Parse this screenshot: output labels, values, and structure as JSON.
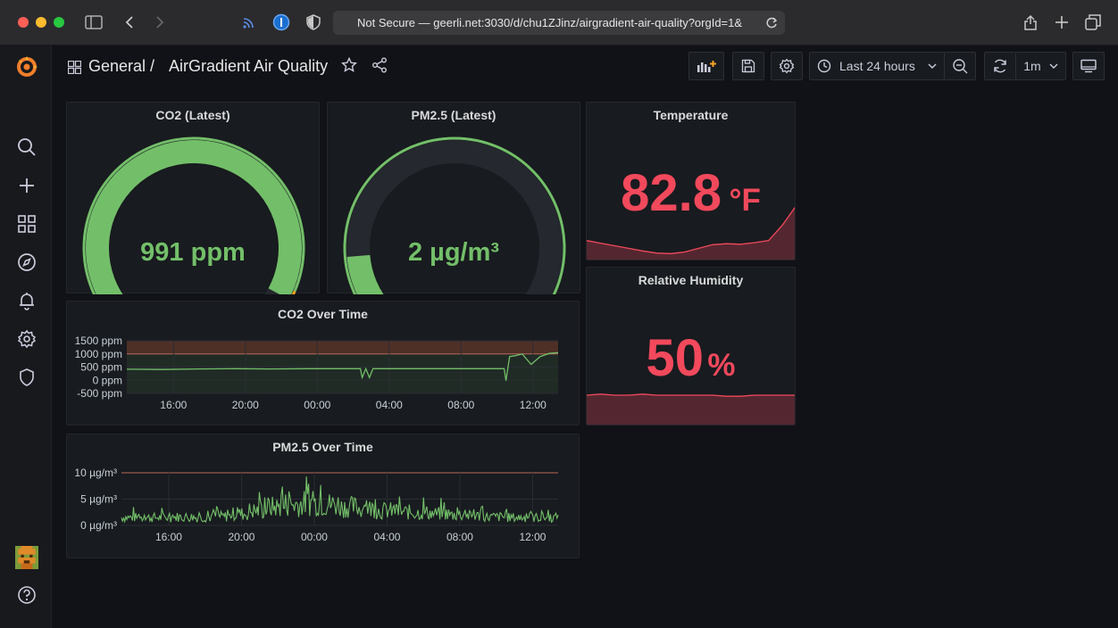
{
  "browser": {
    "url": "Not Secure — geerli.net:3030/d/chu1ZJinz/airgradient-air-quality?orgId=1&"
  },
  "nav": {
    "folder": "General",
    "separator": "/",
    "dashboard_title": "AirGradient Air Quality",
    "time_range": "Last 24 hours",
    "refresh": "1m"
  },
  "panels": {
    "co2_latest": {
      "title": "CO2 (Latest)",
      "value": "991 ppm",
      "gauge_fraction": 0.95,
      "color": "#73bf69"
    },
    "pm25_latest": {
      "title": "PM2.5 (Latest)",
      "value": "2 µg/m³",
      "gauge_fraction": 0.14,
      "color": "#73bf69"
    },
    "temperature": {
      "title": "Temperature",
      "value": "82.8",
      "unit": "°F",
      "color": "#f2495c"
    },
    "humidity": {
      "title": "Relative Humidity",
      "value": "50",
      "unit": "%",
      "color": "#f2495c"
    },
    "co2_time": {
      "title": "CO2 Over Time"
    },
    "pm25_time": {
      "title": "PM2.5 Over Time"
    }
  },
  "chart_data": [
    {
      "type": "line",
      "title": "CO2 Over Time",
      "x_ticks": [
        "16:00",
        "20:00",
        "00:00",
        "04:00",
        "08:00",
        "12:00"
      ],
      "y_ticks": [
        "1500 ppm",
        "1000 ppm",
        "500 ppm",
        "0 ppm",
        "-500 ppm"
      ],
      "y_tick_values": [
        1500,
        1000,
        500,
        0,
        -500
      ],
      "ylim": [
        -500,
        1500
      ],
      "threshold": 1000,
      "x": [
        0,
        2,
        4,
        6,
        8,
        10,
        12,
        13,
        13.1,
        13.3,
        13.5,
        13.7,
        14,
        16,
        18,
        20,
        21,
        21.1,
        21.3,
        21.6,
        22,
        22.5,
        23,
        23.5,
        24
      ],
      "values": [
        420,
        410,
        430,
        440,
        430,
        440,
        440,
        440,
        100,
        440,
        100,
        440,
        440,
        440,
        440,
        440,
        440,
        -20,
        900,
        930,
        1000,
        600,
        900,
        1020,
        1050
      ],
      "color": "#73bf69"
    },
    {
      "type": "line",
      "title": "PM2.5 Over Time",
      "x_ticks": [
        "16:00",
        "20:00",
        "00:00",
        "04:00",
        "08:00",
        "12:00"
      ],
      "y_ticks": [
        "10 µg/m³",
        "5 µg/m³",
        "0 µg/m³"
      ],
      "y_tick_values": [
        10,
        5,
        0
      ],
      "ylim": [
        0,
        10
      ],
      "threshold": 10,
      "x_count": 24,
      "baseline": [
        1.5,
        1.5,
        1.5,
        1.6,
        1.5,
        1.7,
        2.2,
        2.8,
        3.5,
        4.0,
        4.2,
        4.0,
        3.5,
        3.2,
        2.8,
        2.5,
        2.4,
        2.2,
        2.0,
        1.8,
        1.6,
        1.5,
        1.5,
        1.5
      ],
      "color": "#73bf69"
    },
    {
      "type": "area",
      "title": "Temperature sparkline",
      "values": [
        76,
        75.5,
        75,
        74.5,
        74,
        73.6,
        73.5,
        73.8,
        74.5,
        75.2,
        75.4,
        75.3,
        75.6,
        76,
        79,
        82.8
      ],
      "color": "#f2495c"
    },
    {
      "type": "area",
      "title": "Humidity sparkline",
      "values": [
        50,
        51,
        50,
        50,
        51,
        50,
        50,
        50,
        50,
        50,
        49,
        49,
        50,
        50,
        50,
        50
      ],
      "color": "#f2495c"
    }
  ]
}
